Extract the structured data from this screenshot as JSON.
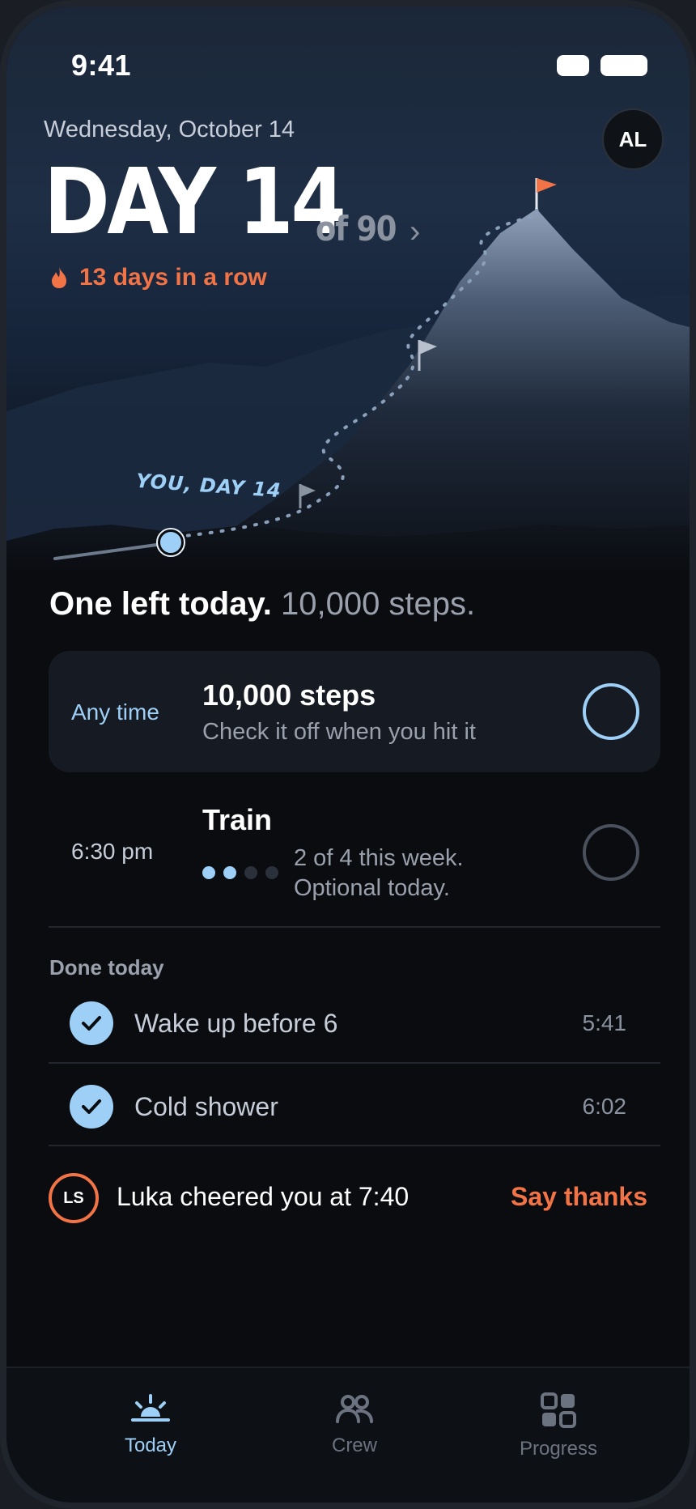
{
  "status_bar": {
    "time": "9:41"
  },
  "header": {
    "date": "Wednesday, October 14",
    "day_label": "DAY 14",
    "of_total": "of 90",
    "chevron": "›",
    "streak_text": "13 days in a row",
    "avatar_initials": "AL"
  },
  "hero": {
    "you_label": "YOU, DAY 14",
    "progress": {
      "current_day": 14,
      "total_days": 90
    }
  },
  "headline": {
    "primary": "One left today.",
    "secondary": "10,000 steps."
  },
  "tasks": [
    {
      "time": "Any time",
      "title": "10,000 steps",
      "subtitle": "Check it off when you hit it",
      "done": false
    },
    {
      "time": "6:30 pm",
      "title": "Train",
      "subtitle_line1": "2 of 4 this week.",
      "subtitle_line2": "Optional today.",
      "done": false,
      "progress": {
        "done": 2,
        "total": 4
      }
    }
  ],
  "done_today": {
    "label": "Done today",
    "items": [
      {
        "title": "Wake up before 6",
        "time": "5:41"
      },
      {
        "title": "Cold shower",
        "time": "6:02"
      }
    ]
  },
  "cheer": {
    "initials": "LS",
    "text": "Luka cheered you at 7:40",
    "action": "Say thanks"
  },
  "tabs": [
    {
      "label": "Today",
      "icon": "sunrise-icon",
      "active": true
    },
    {
      "label": "Crew",
      "icon": "people-icon",
      "active": false
    },
    {
      "label": "Progress",
      "icon": "grid-icon",
      "active": false
    }
  ],
  "colors": {
    "accent": "#9ed0f7",
    "streak": "#f27446",
    "background": "#0a0c10"
  }
}
